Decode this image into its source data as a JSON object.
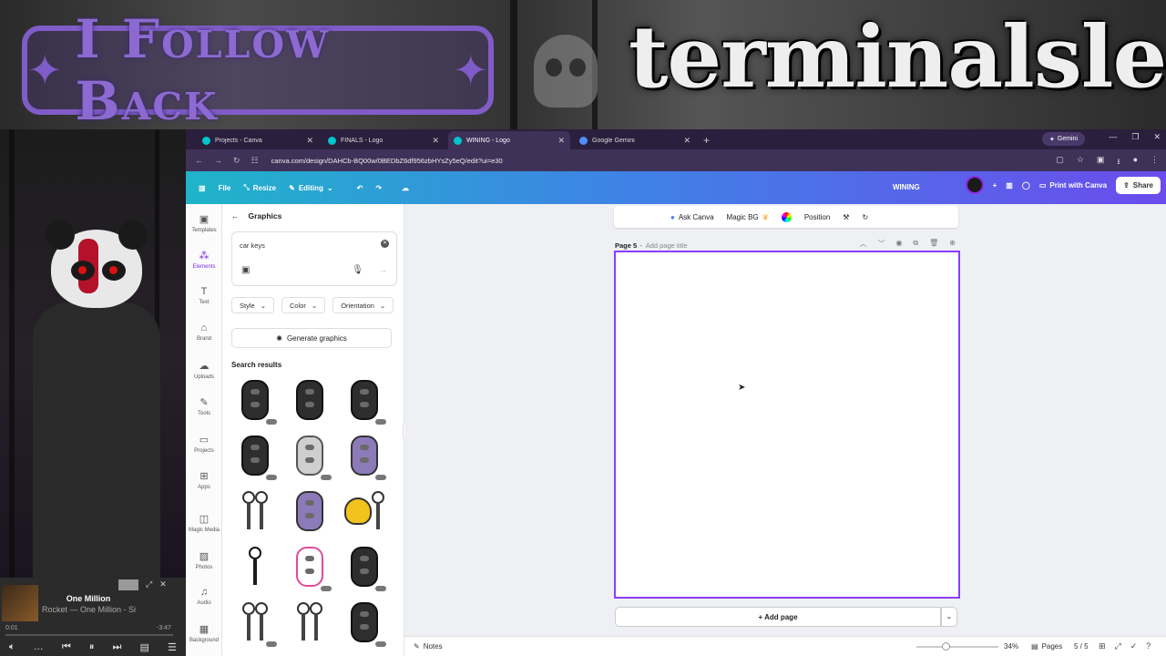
{
  "overlay": {
    "follow_banner": "I Follow Back",
    "brand_name": "terminalsleep"
  },
  "player": {
    "track_title": "One Million",
    "track_subtitle": "Rocket — One Million - Si",
    "time_current": "0:01",
    "time_end": "-3:47",
    "progress": 0.01
  },
  "browser": {
    "tabs": [
      {
        "label": "Projects - Canva",
        "active": false,
        "icon": "canva-favicon"
      },
      {
        "label": "FINALS - Logo",
        "active": false,
        "icon": "canva-favicon"
      },
      {
        "label": "WINING - Logo",
        "active": true,
        "icon": "canva-favicon"
      },
      {
        "label": "Google Gemini",
        "active": false,
        "icon": "gemini-favicon"
      }
    ],
    "gemini_button": "Gemini",
    "url": "canva.com/design/DAHCb-BQ00w/0BEDbZ6df956zbHYsZy5eQ/edit?ui=e30"
  },
  "canva": {
    "file_label": "File",
    "resize_label": "Resize",
    "editing_label": "Editing",
    "design_name": "WINING",
    "print_label": "Print with Canva",
    "share_label": "Share",
    "rail": [
      {
        "label": "Templates",
        "icon": "templates-icon"
      },
      {
        "label": "Elements",
        "icon": "elements-icon",
        "active": true
      },
      {
        "label": "Text",
        "icon": "text-icon"
      },
      {
        "label": "Brand",
        "icon": "brand-icon"
      },
      {
        "label": "Uploads",
        "icon": "uploads-icon"
      },
      {
        "label": "Tools",
        "icon": "tools-icon"
      },
      {
        "label": "Projects",
        "icon": "projects-icon"
      },
      {
        "label": "Apps",
        "icon": "apps-icon"
      },
      {
        "label": "Magic Media",
        "icon": "magic-media-icon"
      },
      {
        "label": "Photos",
        "icon": "photos-icon"
      },
      {
        "label": "Audio",
        "icon": "audio-icon"
      },
      {
        "label": "Background",
        "icon": "background-icon"
      }
    ],
    "panel": {
      "title": "Graphics",
      "search_value": "car keys",
      "filters": [
        "Style",
        "Color",
        "Orientation"
      ],
      "generate_label": "Generate graphics",
      "results_title": "Search results",
      "results": [
        "key-fob-dark",
        "key-fob-dark",
        "key-fob-dark",
        "flip-key",
        "flip-key-grey",
        "key-fob-purple",
        "key-ring",
        "key-fob-purple",
        "heart-lock-key",
        "car-key-black",
        "key-fob-pink",
        "flip-key",
        "key-ring",
        "key-ring",
        "key-fob-dark"
      ]
    },
    "context_toolbar": {
      "ask_canva": "Ask Canva",
      "magic_bg": "Magic BG",
      "position": "Position"
    },
    "page_label": "Page 5",
    "page_title_placeholder": "Add page title",
    "add_page_label": "+ Add page",
    "notes_label": "Notes",
    "zoom": "34%",
    "zoom_level": 0.34,
    "pages_label": "Pages",
    "page_count": "5 / 5"
  }
}
